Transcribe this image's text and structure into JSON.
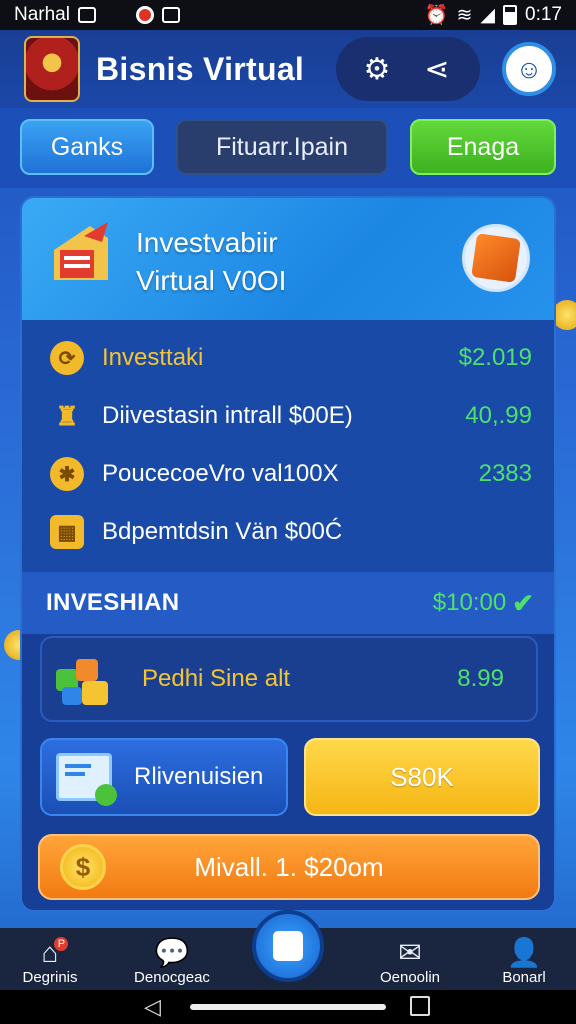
{
  "status_bar": {
    "carrier": "Narhal",
    "time": "0:17"
  },
  "header": {
    "title": "Bisnis Virtual"
  },
  "tabs": [
    {
      "label": "Ganks"
    },
    {
      "label": "Fituarr.Ipain"
    },
    {
      "label": "Enaga"
    }
  ],
  "panel": {
    "title_line1": "Investvabiir",
    "title_line2": "Virtual V0OI",
    "rows": [
      {
        "label": "Investtaki",
        "value": "$2.019",
        "icon": "refresh-coin-icon"
      },
      {
        "label": "Diivestasin intrall $00E)",
        "value": "40,.99",
        "icon": "trophy-icon"
      },
      {
        "label": "PoucecoeVro val100X",
        "value": "2383",
        "icon": "gear-coin-icon"
      },
      {
        "label": "Bdpemtdsin Vän $00Ć",
        "value": "",
        "icon": "calculator-icon"
      }
    ],
    "invest": {
      "label": "INVESHIAN",
      "value": "$10:00"
    },
    "card": {
      "label": "Pedhi Sine alt",
      "value": "8.99"
    },
    "btn_diversify": "Rlivenuisien",
    "btn_yellow": "S80K",
    "btn_orange": "Mivall. 1. $20om"
  },
  "bottom_nav": [
    {
      "label": "Degrinis",
      "icon": "home-icon",
      "badge": "P"
    },
    {
      "label": "Denocgeac",
      "icon": "chat-icon"
    },
    {
      "label": "",
      "icon": "center-action-icon"
    },
    {
      "label": "Oenoolin",
      "icon": "mail-icon"
    },
    {
      "label": "Bonarl",
      "icon": "user-icon"
    }
  ],
  "colors": {
    "accent_green": "#4fe06c",
    "gold": "#f5c531",
    "orange": "#f27a12",
    "yellow": "#f5b614"
  }
}
